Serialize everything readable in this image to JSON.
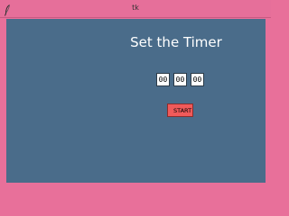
{
  "window": {
    "title": "tk",
    "icon": "feather-icon"
  },
  "main": {
    "heading": "Set the Timer",
    "hours": "00",
    "minutes": "00",
    "seconds": "00",
    "start_label": "START"
  },
  "colors": {
    "frame": "#e8709a",
    "background": "#4a6c8a",
    "button": "#f05a5a",
    "text": "#ffffff"
  }
}
